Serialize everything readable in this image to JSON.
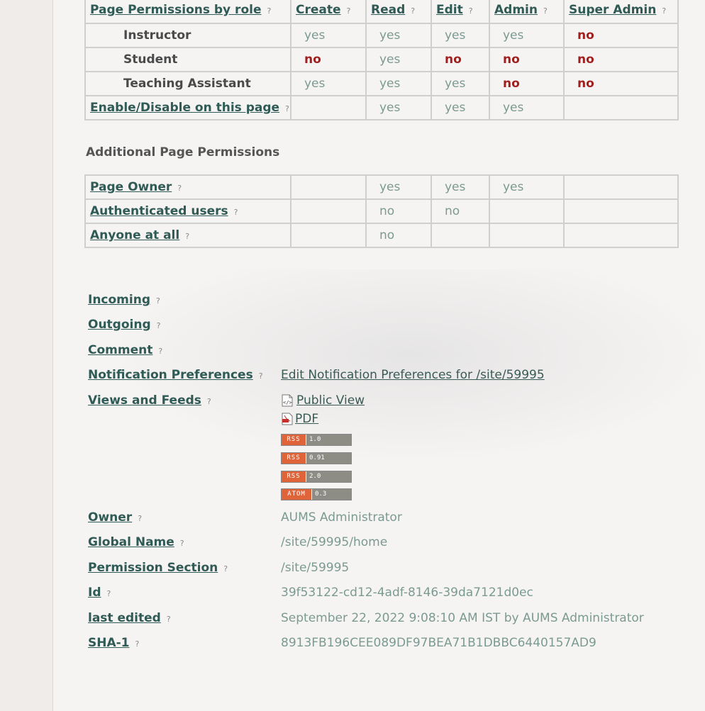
{
  "perms": {
    "header": [
      "Page Permissions by role",
      "Create",
      "Read",
      "Edit",
      "Admin",
      "Super Admin"
    ],
    "roles": [
      {
        "name": "Instructor",
        "cells": [
          "yes",
          "yes",
          "yes",
          "yes",
          "no"
        ]
      },
      {
        "name": "Student",
        "cells": [
          "no",
          "yes",
          "no",
          "no",
          "no"
        ]
      },
      {
        "name": "Teaching Assistant",
        "cells": [
          "yes",
          "yes",
          "yes",
          "no",
          "no"
        ]
      }
    ],
    "enable": {
      "name": "Enable/Disable on this page",
      "cells": [
        "",
        "yes",
        "yes",
        "yes",
        ""
      ]
    },
    "help": "?"
  },
  "additional": {
    "title": "Additional Page Permissions",
    "rows": [
      {
        "name": "Page Owner",
        "cells": [
          "",
          "yes",
          "yes",
          "yes",
          ""
        ]
      },
      {
        "name": "Authenticated users",
        "cells": [
          "",
          "no",
          "no",
          "",
          ""
        ]
      },
      {
        "name": "Anyone at all",
        "cells": [
          "",
          "no",
          "",
          "",
          ""
        ]
      }
    ]
  },
  "props": {
    "incoming": "Incoming",
    "outgoing": "Outgoing",
    "comment": "Comment",
    "notif_label": "Notification Preferences",
    "notif_value": "Edit Notification Preferences for /site/59995",
    "views_label": "Views and Feeds",
    "public_view": "Public View",
    "pdf": "PDF",
    "feeds": [
      {
        "left": "RSS",
        "right": "1.0"
      },
      {
        "left": "RSS",
        "right": "0.91"
      },
      {
        "left": "RSS",
        "right": "2.0"
      },
      {
        "left": "ATOM",
        "right": "0.3"
      }
    ],
    "owner_label": "Owner",
    "owner_value": "AUMS Administrator",
    "global_label": "Global Name",
    "global_value": "/site/59995/home",
    "permsec_label": "Permission Section",
    "permsec_value": "/site/59995",
    "id_label": "Id",
    "id_value": "39f53122-cd12-4adf-8146-39da7121d0ec",
    "edited_label": "last edited",
    "edited_value": "September 22, 2022 9:08:10 AM IST by AUMS Administrator",
    "sha_label": "SHA-1",
    "sha_value": "8913FB196CEE089DF97BEA71B1DBBC6440157AD9"
  }
}
